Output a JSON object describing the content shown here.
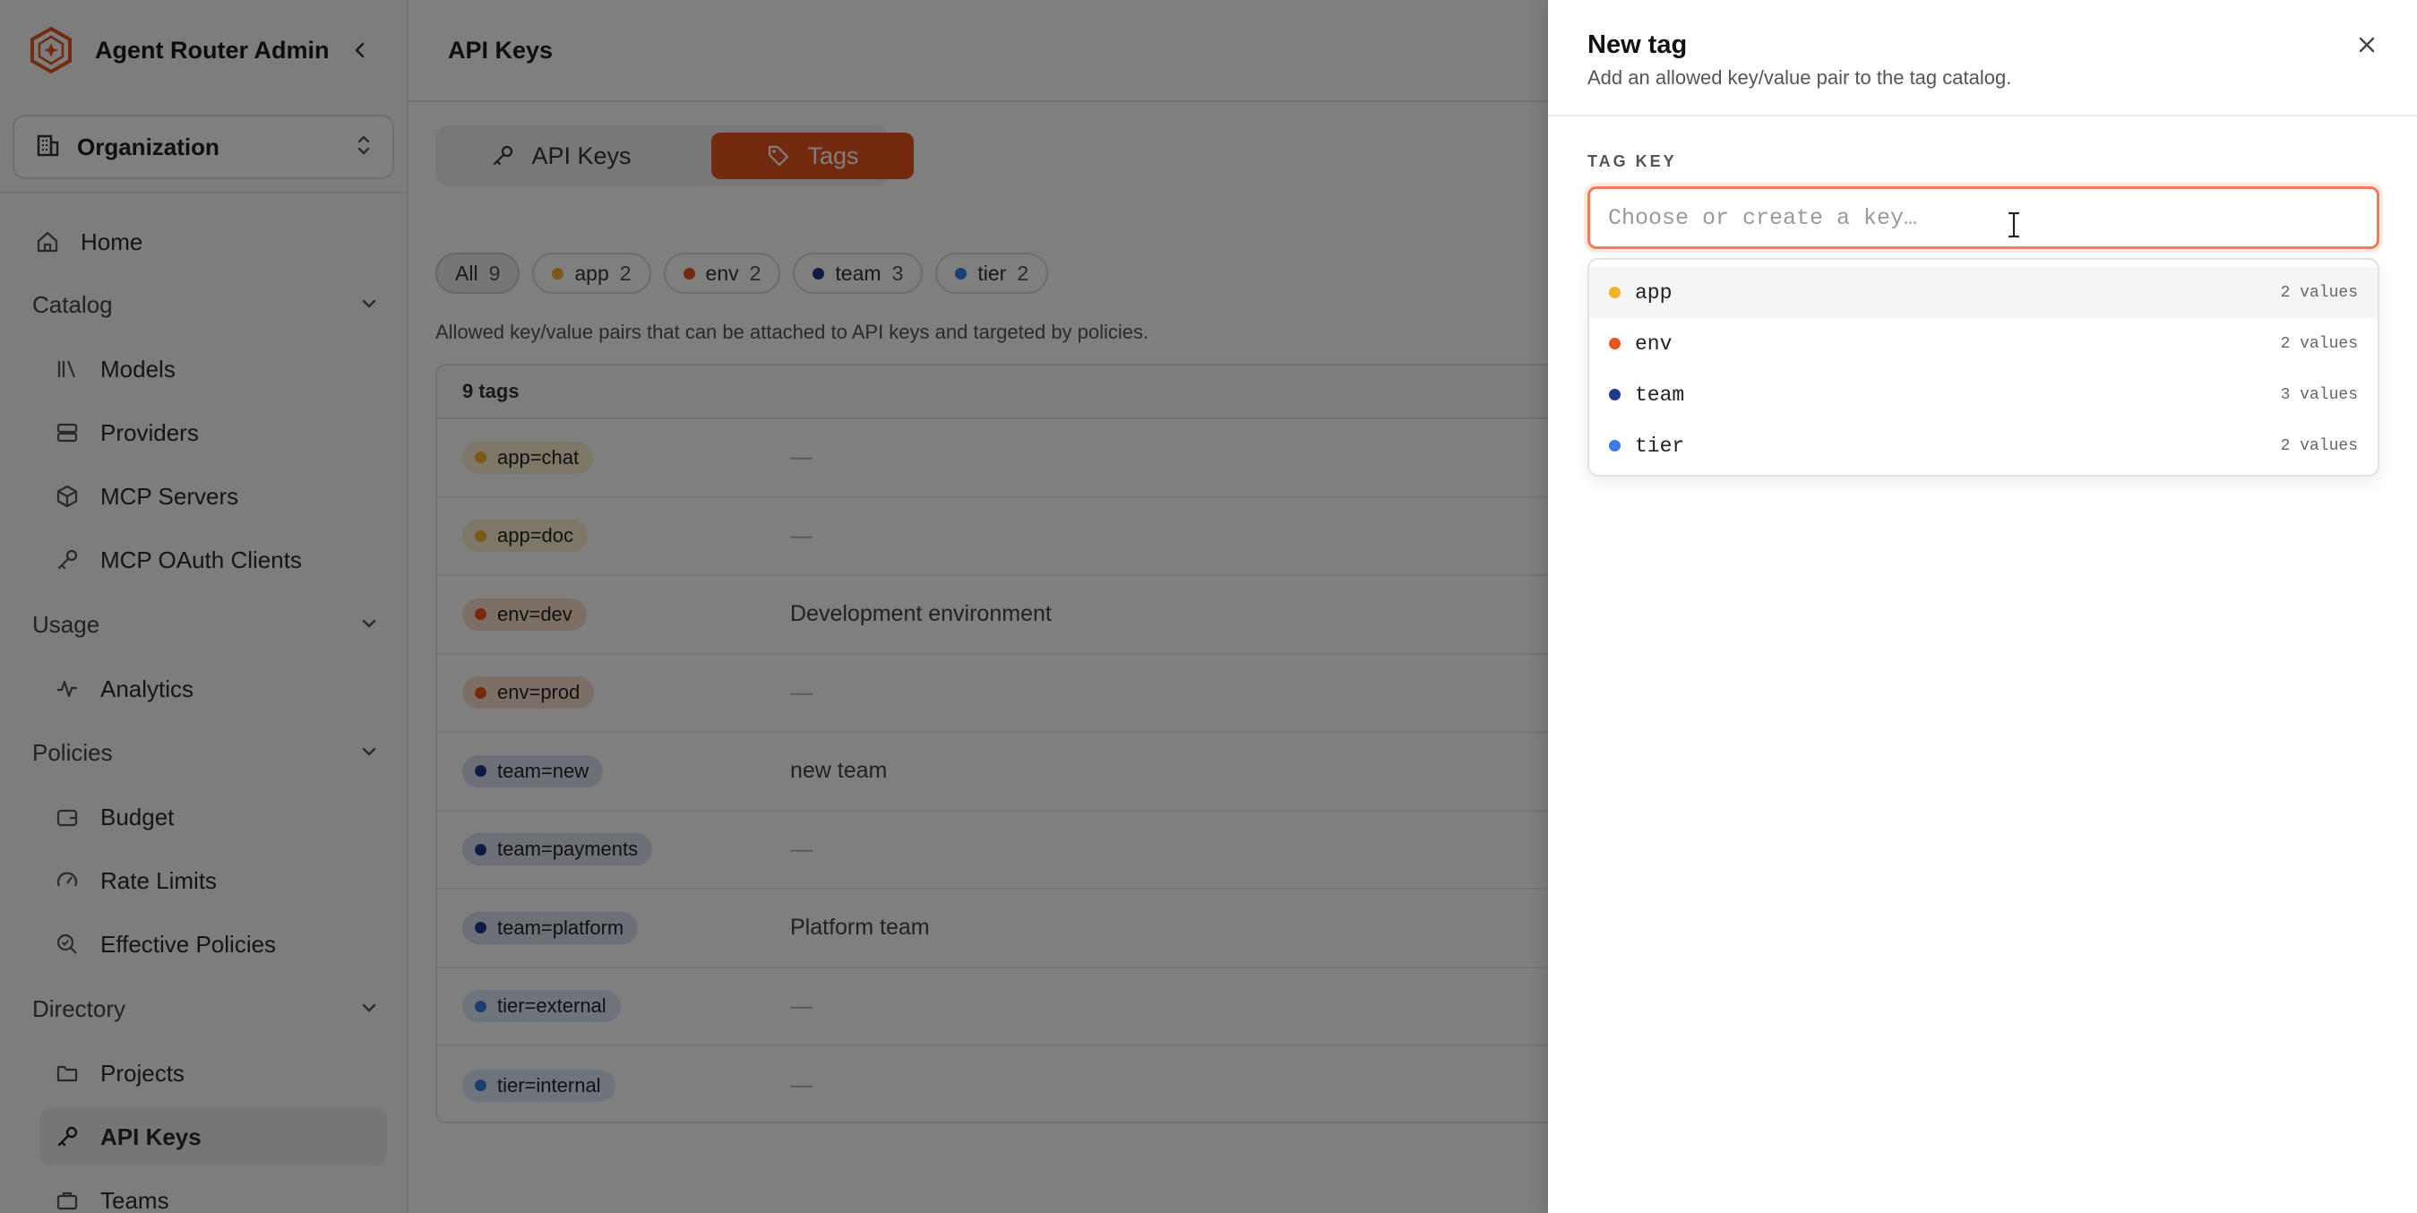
{
  "brand": {
    "title": "Agent Router Admin"
  },
  "org_switcher": {
    "label": "Organization"
  },
  "nav": {
    "home": "Home",
    "catalog": {
      "label": "Catalog",
      "items": [
        "Models",
        "Providers",
        "MCP Servers",
        "MCP OAuth Clients"
      ]
    },
    "usage": {
      "label": "Usage",
      "items": [
        "Analytics"
      ]
    },
    "policies": {
      "label": "Policies",
      "items": [
        "Budget",
        "Rate Limits",
        "Effective Policies"
      ]
    },
    "directory": {
      "label": "Directory",
      "items": [
        "Projects",
        "API Keys",
        "Teams"
      ]
    }
  },
  "main": {
    "page_title": "API Keys",
    "tabs": [
      {
        "label": "API Keys"
      },
      {
        "label": "Tags",
        "active": true
      }
    ],
    "filters": [
      {
        "label": "All",
        "count": "9",
        "color": ""
      },
      {
        "label": "app",
        "count": "2",
        "color": "#f0b429"
      },
      {
        "label": "env",
        "count": "2",
        "color": "#e8541c"
      },
      {
        "label": "team",
        "count": "3",
        "color": "#1e3a8a"
      },
      {
        "label": "tier",
        "count": "2",
        "color": "#3b7de0"
      }
    ],
    "description": "Allowed key/value pairs that can be attached to API keys and targeted by policies.",
    "table": {
      "count_label": "9 tags",
      "rows": [
        {
          "tag": "app=chat",
          "desc": "—",
          "color": "#f0b429",
          "bg": "#fbefd0"
        },
        {
          "tag": "app=doc",
          "desc": "—",
          "color": "#f0b429",
          "bg": "#fbefd0"
        },
        {
          "tag": "env=dev",
          "desc": "Development environment",
          "color": "#e8541c",
          "bg": "#fbdccd"
        },
        {
          "tag": "env=prod",
          "desc": "—",
          "color": "#e8541c",
          "bg": "#fbdccd"
        },
        {
          "tag": "team=new",
          "desc": "new team",
          "color": "#1e3a8a",
          "bg": "#dde1ee"
        },
        {
          "tag": "team=payments",
          "desc": "—",
          "color": "#1e3a8a",
          "bg": "#dde1ee"
        },
        {
          "tag": "team=platform",
          "desc": "Platform team",
          "color": "#1e3a8a",
          "bg": "#dde1ee"
        },
        {
          "tag": "tier=external",
          "desc": "—",
          "color": "#3b7de0",
          "bg": "#dce7f9"
        },
        {
          "tag": "tier=internal",
          "desc": "—",
          "color": "#3b7de0",
          "bg": "#dce7f9"
        }
      ]
    }
  },
  "drawer": {
    "title": "New tag",
    "subtitle": "Add an allowed key/value pair to the tag catalog.",
    "field_label": "TAG KEY",
    "input_placeholder": "Choose or create a key…",
    "options": [
      {
        "key": "app",
        "count": "2 values",
        "color": "#f0b429"
      },
      {
        "key": "env",
        "count": "2 values",
        "color": "#e8541c"
      },
      {
        "key": "team",
        "count": "3 values",
        "color": "#1e3a8a"
      },
      {
        "key": "tier",
        "count": "2 values",
        "color": "#3b7de0"
      }
    ]
  },
  "colors": {
    "accent": "#e8541c"
  }
}
